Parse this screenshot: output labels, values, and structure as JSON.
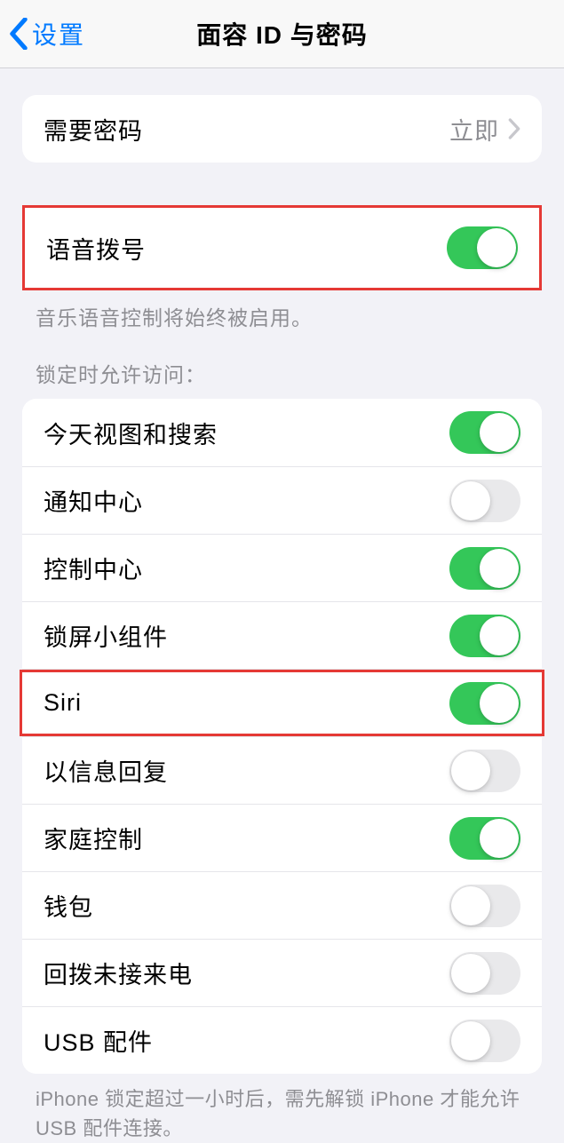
{
  "nav": {
    "back_label": "设置",
    "title": "面容 ID 与密码"
  },
  "passcode": {
    "label": "需要密码",
    "value": "立即"
  },
  "voice_dial": {
    "label": "语音拨号",
    "footer": "音乐语音控制将始终被启用。"
  },
  "lock_header": "锁定时允许访问：",
  "lock_items": {
    "today": "今天视图和搜索",
    "notifications": "通知中心",
    "control": "控制中心",
    "widgets": "锁屏小组件",
    "siri": "Siri",
    "reply": "以信息回复",
    "home": "家庭控制",
    "wallet": "钱包",
    "callback": "回拨未接来电",
    "usb": "USB 配件"
  },
  "lock_states": {
    "today": true,
    "notifications": false,
    "control": true,
    "widgets": true,
    "siri": true,
    "reply": false,
    "home": true,
    "wallet": false,
    "callback": false,
    "usb": false
  },
  "usb_footer": "iPhone 锁定超过一小时后，需先解锁 iPhone 才能允许 USB 配件连接。"
}
